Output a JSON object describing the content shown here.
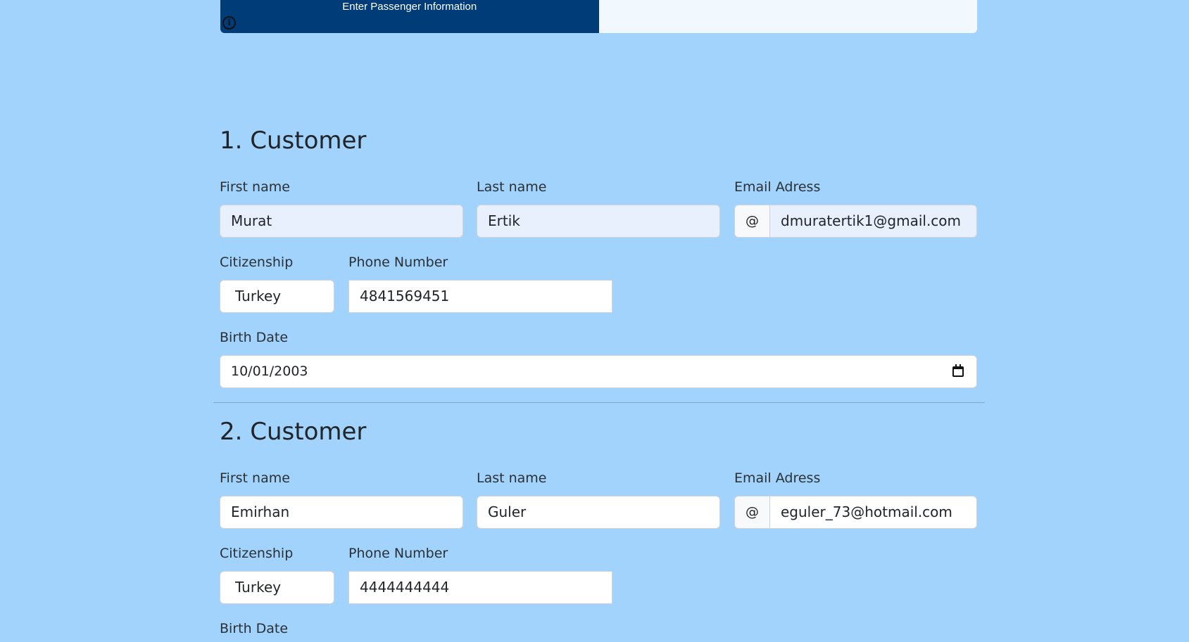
{
  "progress": {
    "label": "Enter Passenger Information",
    "percent": 50
  },
  "labels": {
    "first_name": "First name",
    "last_name": "Last name",
    "email": "Email Adress",
    "citizenship": "Citizenship",
    "phone": "Phone Number",
    "birth_date": "Birth Date",
    "email_prefix": "@"
  },
  "customers": [
    {
      "title": "1. Customer",
      "first_name": "Murat",
      "last_name": "Ertik",
      "email": "dmuratertik1@gmail.com",
      "citizenship": "Turkey",
      "phone": "4841569451",
      "birth_date": "10/01/2003"
    },
    {
      "title": "2. Customer",
      "first_name": "Emirhan",
      "last_name": "Guler",
      "email": "eguler_73@hotmail.com",
      "citizenship": "Turkey",
      "phone": "4444444444"
    }
  ],
  "colors": {
    "page_background": "#a1d3fc",
    "progress_fill": "#003d78",
    "progress_track": "#f1f9ff",
    "autofill_background": "#e8f0fe"
  },
  "icons": {
    "info": "info-icon",
    "calendar": "calendar-icon"
  }
}
